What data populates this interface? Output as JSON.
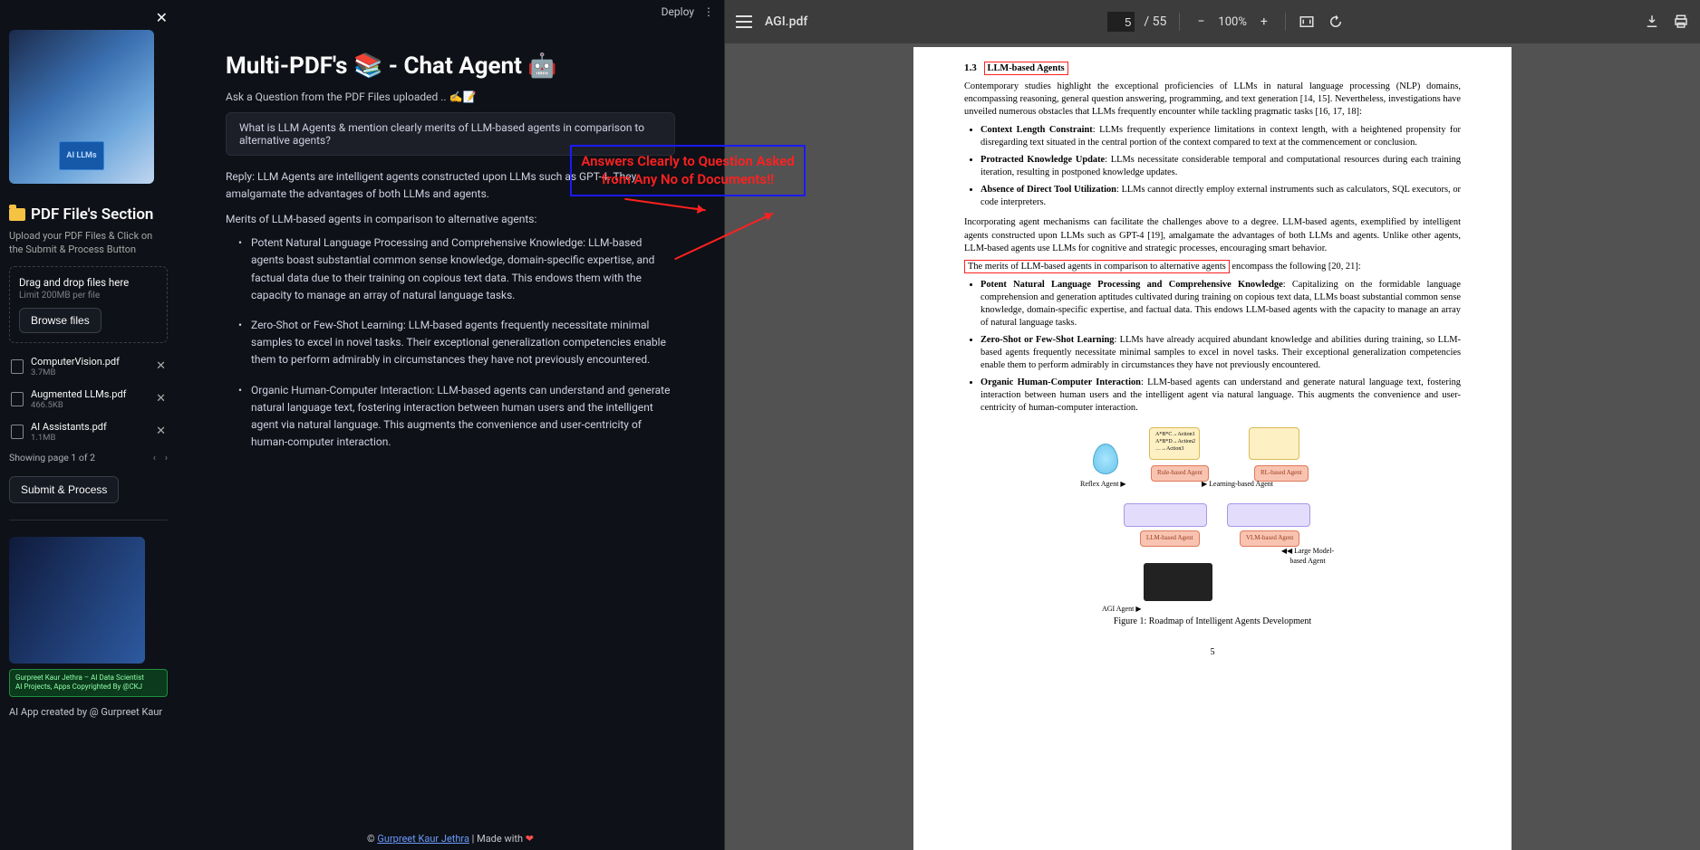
{
  "sidebar": {
    "section_title": "PDF File's Section",
    "help_text": "Upload your PDF Files & Click on the Submit & Process Button",
    "dropzone_main": "Drag and drop files here",
    "dropzone_sub": "Limit 200MB per file",
    "browse_label": "Browse files",
    "files": [
      {
        "name": "ComputerVision.pdf",
        "size": "3.7MB"
      },
      {
        "name": "Augmented LLMs.pdf",
        "size": "466.5KB"
      },
      {
        "name": "AI Assistants.pdf",
        "size": "1.1MB"
      }
    ],
    "pager_text": "Showing page 1 of 2",
    "submit_label": "Submit & Process",
    "profile_badge_line1": "Gurpreet Kaur Jethra – AI Data Scientist",
    "profile_badge_line2": "AI Projects, Apps Copyrighted By @CKJ",
    "credit": "AI App created by @ Gurpreet Kaur",
    "robot_book_text": "AI LLMs"
  },
  "main": {
    "deploy_label": "Deploy",
    "title": "Multi-PDF's 📚 - Chat Agent 🤖",
    "subtitle": "Ask a Question from the PDF Files uploaded .. ✍️📝",
    "question": "What is LLM Agents & mention clearly merits of LLM-based agents in comparison to alternative agents?",
    "reply": "Reply: LLM Agents are intelligent agents constructed upon LLMs such as GPT-4. They amalgamate the advantages of both LLMs and agents.",
    "merits_heading": "Merits of LLM-based agents in comparison to alternative agents:",
    "bullets": [
      "Potent Natural Language Processing and Comprehensive Knowledge: LLM-based agents boast substantial common sense knowledge, domain-specific expertise, and factual data due to their training on copious text data. This endows them with the capacity to manage an array of natural language tasks.",
      "Zero-Shot or Few-Shot Learning: LLM-based agents frequently necessitate minimal samples to excel in novel tasks. Their exceptional generalization competencies enable them to perform admirably in circumstances they have not previously encountered.",
      "Organic Human-Computer Interaction: LLM-based agents can understand and generate natural language text, fostering interaction between human users and the intelligent agent via natural language. This augments the convenience and user-centricity of human-computer interaction."
    ],
    "annotation_line1": "Answers Clearly to Question Asked",
    "annotation_line2": "from Any No of Documents!!",
    "footer_copyright": "© ",
    "footer_author": "Gurpreet Kaur Jethra",
    "footer_made": " | Made with "
  },
  "pdf": {
    "filename": "AGI.pdf",
    "page_current": "5",
    "page_total": "/ 55",
    "zoom": "100%",
    "section_number": "1.3",
    "section_title": "LLM-based Agents",
    "intro": "Contemporary studies highlight the exceptional proficiencies of LLMs in natural language processing (NLP) domains, encompassing reasoning, general question answering, programming, and text generation [14, 15]. Nevertheless, investigations have unveiled numerous obstacles that LLMs frequently encounter while tackling pragmatic tasks [16, 17, 18]:",
    "limits": [
      {
        "b": "Context Length Constraint",
        "t": ": LLMs frequently experience limitations in context length, with a heightened propensity for disregarding text situated in the central portion of the context compared to text at the commencement or conclusion."
      },
      {
        "b": "Protracted Knowledge Update",
        "t": ": LLMs necessitate considerable temporal and computational resources during each training iteration, resulting in postponed knowledge updates."
      },
      {
        "b": "Absence of Direct Tool Utilization",
        "t": ": LLMs cannot directly employ external instruments such as calculators, SQL executors, or code interpreters."
      }
    ],
    "bridge1": "Incorporating agent mechanisms can facilitate the challenges above to a degree. LLM-based agents, exemplified by intelligent agents constructed upon LLMs such as GPT-4 [19], amalgamate the advantages of both LLMs and agents. Unlike other agents, LLM-based agents use LLMs for cognitive and strategic processes, encouraging smart behavior.",
    "merits_line_boxed": "The merits of LLM-based agents in comparison to alternative agents",
    "merits_line_after": " encompass the following [20, 21]:",
    "merits": [
      {
        "b": "Potent Natural Language Processing and Comprehensive Knowledge",
        "t": ": Capitalizing on the formidable language comprehension and generation aptitudes cultivated during training on copious text data, LLMs boast substantial common sense knowledge, domain-specific expertise, and factual data. This endows LLM-based agents with the capacity to manage an array of natural language tasks."
      },
      {
        "b": "Zero-Shot or Few-Shot Learning",
        "t": ": LLMs have already acquired abundant knowledge and abilities during training, so LLM-based agents frequently necessitate minimal samples to excel in novel tasks. Their exceptional generalization competencies enable them to perform admirably in circumstances they have not previously encountered."
      },
      {
        "b": "Organic Human-Computer Interaction",
        "t": ": LLM-based agents can understand and generate natural language text, fostering interaction between human users and the intelligent agent via natural language. This augments the convenience and user-centricity of human-computer interaction."
      }
    ],
    "labels": {
      "reflex": "Reflex Agent ▶",
      "learning": "▶ Learning-based Agent",
      "agi": "AGI Agent ▶",
      "large": "◀◀ Large Model-based Agent",
      "rule": "Rule-based Agent",
      "rl": "RL-based Agent",
      "llm": "LLM-based Agent",
      "vlm": "VLM-based Agent"
    },
    "fig_caption": "Figure 1: Roadmap of Intelligent Agents Development",
    "page_number": "5"
  }
}
